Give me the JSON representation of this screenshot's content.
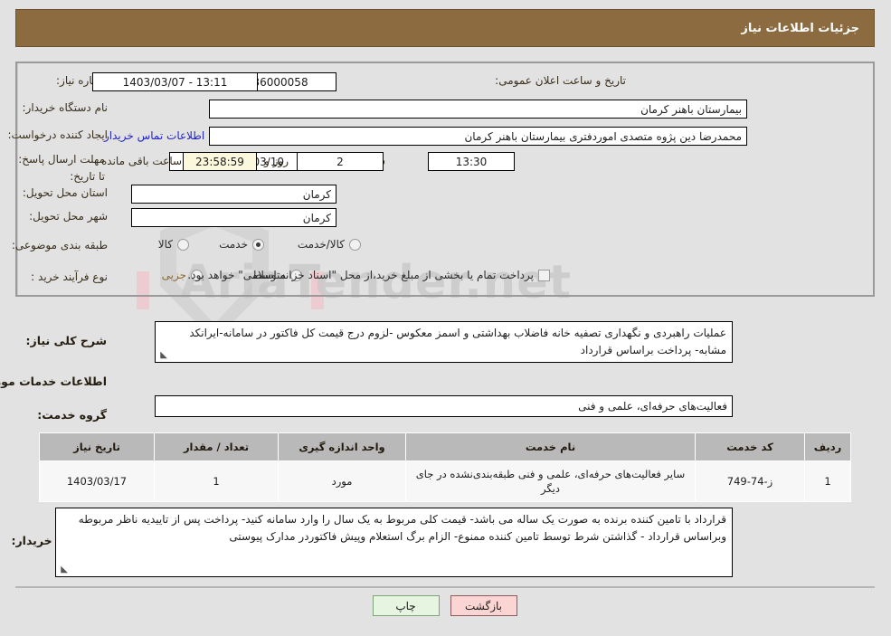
{
  "header": {
    "title": "جزئیات اطلاعات نیاز"
  },
  "form": {
    "need_number_label": "شماره نیاز:",
    "need_number_value": "1103094336000058",
    "announce_label": "تاریخ و ساعت اعلان عمومی:",
    "announce_value": "1403/03/07 - 13:11",
    "buyer_org_label": "نام دستگاه خریدار:",
    "buyer_org_value": "بیمارستان باهنر کرمان",
    "creator_label": "ایجاد کننده درخواست:",
    "creator_value": "محمدرضا  دین پژوه متصدی اموردفتری بیمارستان باهنر کرمان",
    "contact_link": "اطلاعات تماس خریدار",
    "deadline_label": "مهلت ارسال پاسخ: تا تاریخ:",
    "deadline_date": "1403/03/10",
    "hour_label": "ساعت",
    "deadline_time": "13:30",
    "days_value": "2",
    "days_label": "روز و",
    "countdown": "23:58:59",
    "remaining_label": "ساعت باقی مانده",
    "province_label": "استان محل تحویل:",
    "province_value": "کرمان",
    "city_label": "شهر محل تحویل:",
    "city_value": "کرمان",
    "category_label": "طبقه بندی موضوعی:",
    "category_options": [
      {
        "label": "کالا",
        "selected": false
      },
      {
        "label": "خدمت",
        "selected": true
      },
      {
        "label": "کالا/خدمت",
        "selected": false
      }
    ],
    "process_label": "نوع فرآیند خرید :",
    "process_options": [
      {
        "label": "جزیی",
        "selected": false
      },
      {
        "label": "متوسط",
        "selected": false
      }
    ],
    "treasury_checkbox_label": "پرداخت تمام یا بخشی از مبلغ خرید،از محل \"اسناد خزانه اسلامی\" خواهد بود.",
    "treasury_checked": false
  },
  "summary": {
    "label": "شرح کلی نیاز:",
    "value": "عملیات راهبردی و نگهداری تصفیه خانه فاضلاب بهداشتی و اسمز معکوس -لزوم درج قیمت کل فاکتور در سامانه-ایرانکد مشابه- پرداخت براساس قرارداد"
  },
  "services_section": {
    "title": "اطلاعات خدمات مورد نیاز",
    "group_label": "گروه خدمت:",
    "group_value": "فعالیت‌های حرفه‌ای، علمی و فنی"
  },
  "table": {
    "columns": [
      "ردیف",
      "کد خدمت",
      "نام خدمت",
      "واحد اندازه گیری",
      "تعداد / مقدار",
      "تاریخ نیاز"
    ],
    "rows": [
      {
        "row_no": "1",
        "service_code": "ز-74-749",
        "service_name": "سایر فعالیت‌های حرفه‌ای، علمی و فنی طبقه‌بندی‌نشده در جای دیگر",
        "unit": "مورد",
        "quantity": "1",
        "need_date": "1403/03/17"
      }
    ]
  },
  "buyer_notes": {
    "label": "توضیحات خریدار:",
    "value": "قرارداد با تامین کننده برنده به صورت یک ساله می باشد- قیمت کلی مربوط به یک سال را وارد سامانه کنید- پرداخت پس از تاییدیه ناظر مربوطه وبراساس قرارداد - گذاشتن شرط توسط تامین کننده ممنوع- الزام برگ استعلام وپیش فاکتوردر مدارک پیوستی"
  },
  "buttons": {
    "print": "چاپ",
    "back": "بازگشت"
  },
  "colors": {
    "header_bar": "#8c6b41",
    "page_bg": "#e2e2e2",
    "link": "#2222cc",
    "accent_text": "#8a6a33",
    "table_header": "#b9b9b9",
    "btn_print": "#e6f5e0",
    "btn_back": "#fbd5d3"
  },
  "watermark": {
    "text": "AriaTender.net"
  }
}
